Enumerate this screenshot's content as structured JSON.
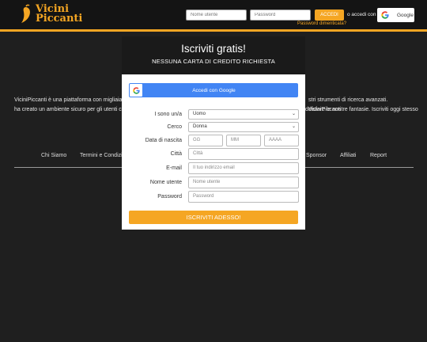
{
  "header": {
    "logo_line1": "Vicini",
    "logo_line2": "Piccanti",
    "username_placeholder": "Nome utente",
    "password_placeholder": "Password",
    "login_label": "ACCEDI",
    "or_login_with": "o accedi con",
    "google_label": "Google",
    "forgot_password": "Password dimenticata?",
    "accent_color": "#f5a623"
  },
  "background": {
    "intro_left_line1": "ViciniPiccanti è una piattaforma con migliaia d",
    "intro_left_line2": "ha creato un ambiente sicuro per gli utenti che",
    "intro_right_line1": "stri strumenti di ricerca avanzati. ViciniPiccanti",
    "intro_right_line2": "ddisfare le nostre fantasie. Iscriviti oggi stesso",
    "footer_links": [
      "Chi Siamo",
      "Termini e Condizio",
      "Sponsor",
      "Affiliati",
      "Report"
    ]
  },
  "modal": {
    "title": "Iscriviti gratis!",
    "subtitle": "NESSUNA CARTA DI CREDITO RICHIESTA",
    "google_button": "Accedi con Google",
    "fields": {
      "i_am_label": "I sono un/a",
      "i_am_value": "Uomo",
      "seeking_label": "Cerco",
      "seeking_value": "Donna",
      "birthdate_label": "Data di nascita",
      "day_placeholder": "GG",
      "month_placeholder": "MM",
      "year_placeholder": "AAAA",
      "city_label": "Città",
      "city_placeholder": "Città",
      "email_label": "E-mail",
      "email_placeholder": "Il tuo indirizzo email",
      "username_label": "Nome utente",
      "username_placeholder": "Nome utente",
      "password_label": "Password",
      "password_placeholder": "Password"
    },
    "submit_label": "ISCRIVITI ADESSO!"
  }
}
